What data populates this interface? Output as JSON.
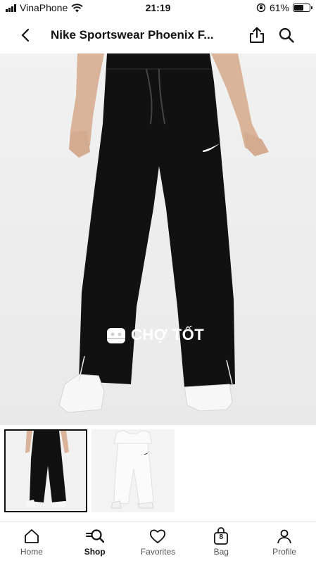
{
  "status_bar": {
    "carrier": "VinaPhone",
    "time": "21:19",
    "battery_percent": "61%",
    "battery_level": 0.61
  },
  "header": {
    "title": "Nike Sportswear Phoenix F...",
    "back_icon": "chevron-left-icon",
    "share_icon": "share-icon",
    "search_icon": "search-icon"
  },
  "hero": {
    "watermark": "CHỢ TỐT",
    "carousel_count": 7,
    "carousel_active": 0
  },
  "nav": {
    "items": [
      {
        "label": "Home",
        "icon": "home-icon"
      },
      {
        "label": "Shop",
        "icon": "shop-search-icon"
      },
      {
        "label": "Favorites",
        "icon": "heart-icon"
      },
      {
        "label": "Bag",
        "icon": "bag-icon",
        "badge": "8"
      },
      {
        "label": "Profile",
        "icon": "profile-icon"
      }
    ]
  }
}
